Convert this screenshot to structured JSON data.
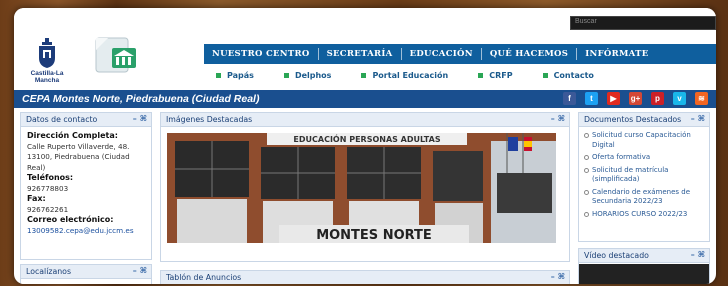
{
  "header": {
    "logo_text": "Castilla-La Mancha",
    "search_placeholder": "Buscar",
    "nav_main": [
      "NUESTRO CENTRO",
      "SECRETARÍA",
      "EDUCACIÓN",
      "QUÉ HACEMOS",
      "INFÓRMATE"
    ],
    "nav_sub": [
      "Papás",
      "Delphos",
      "Portal Educación",
      "CRFP",
      "Contacto"
    ]
  },
  "title_bar": {
    "title": "CEPA Montes Norte, Piedrabuena (Ciudad Real)",
    "social_icons": [
      {
        "name": "facebook-icon",
        "glyph": "f",
        "color": "#3b5998"
      },
      {
        "name": "twitter-icon",
        "glyph": "t",
        "color": "#1da1f2"
      },
      {
        "name": "youtube-icon",
        "glyph": "▶",
        "color": "#e02a20"
      },
      {
        "name": "google-plus-icon",
        "glyph": "g+",
        "color": "#d34836"
      },
      {
        "name": "pinterest-icon",
        "glyph": "p",
        "color": "#cb2027"
      },
      {
        "name": "vimeo-icon",
        "glyph": "v",
        "color": "#1ab7ea"
      },
      {
        "name": "rss-icon",
        "glyph": "≋",
        "color": "#f26522"
      }
    ]
  },
  "contact": {
    "heading": "Datos de contacto",
    "controls": "– ⌘",
    "address_label": "Dirección Completa:",
    "address": "Calle Ruperto Villaverde, 48. 13100, Piedrabuena (Ciudad Real)",
    "phone_label": "Teléfonos:",
    "phone": "926778803",
    "fax_label": "Fax:",
    "fax": "926762261",
    "email_label": "Correo electrónico:",
    "email": "13009582.cepa@edu.jccm.es"
  },
  "location": {
    "heading": "Localízanos"
  },
  "images": {
    "heading": "Imágenes Destacadas",
    "sign_text": "MONTES NORTE",
    "top_sign_text": "EDUCACIÓN PERSONAS ADULTAS"
  },
  "board": {
    "heading": "Tablón de Anuncios"
  },
  "documents": {
    "heading": "Documentos Destacados",
    "items": [
      "Solicitud curso Capacitación Digital",
      "Oferta formativa",
      "Solicitud de matrícula (simplificada)",
      "Calendario de exámenes de Secundaria 2022/23",
      "HORARIOS CURSO 2022/23"
    ]
  },
  "video": {
    "heading": "Vídeo destacado"
  }
}
